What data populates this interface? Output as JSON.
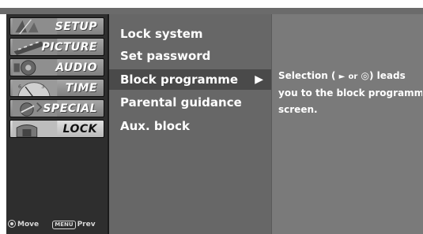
{
  "left_menu": {
    "items": [
      {
        "label": "SETUP"
      },
      {
        "label": "PICTURE"
      },
      {
        "label": "AUDIO"
      },
      {
        "label": "TIME"
      },
      {
        "label": "SPECIAL"
      },
      {
        "label": "LOCK"
      }
    ],
    "selected": "LOCK",
    "legend": {
      "move": "Move",
      "menu_key": "MENU",
      "prev": "Prev"
    }
  },
  "lock_menu": {
    "items": [
      {
        "label": "Lock system"
      },
      {
        "label": "Set password"
      },
      {
        "label": "Block programme"
      },
      {
        "label": "Parental guidance"
      },
      {
        "label": "Aux. block"
      }
    ],
    "selected": "Block programme",
    "submenu_arrow": "▶"
  },
  "description": {
    "line1_prefix": "Selection (",
    "right_symbol": "►",
    "or_text": "or",
    "ok_symbol": "◎",
    "line1_suffix": ") leads",
    "line2": "you to the block programme",
    "line3": "screen."
  },
  "icons": [
    "move-icon",
    "menu-key-icon",
    "submenu-arrow-icon",
    "right-arrow-icon",
    "ok-button-icon"
  ]
}
